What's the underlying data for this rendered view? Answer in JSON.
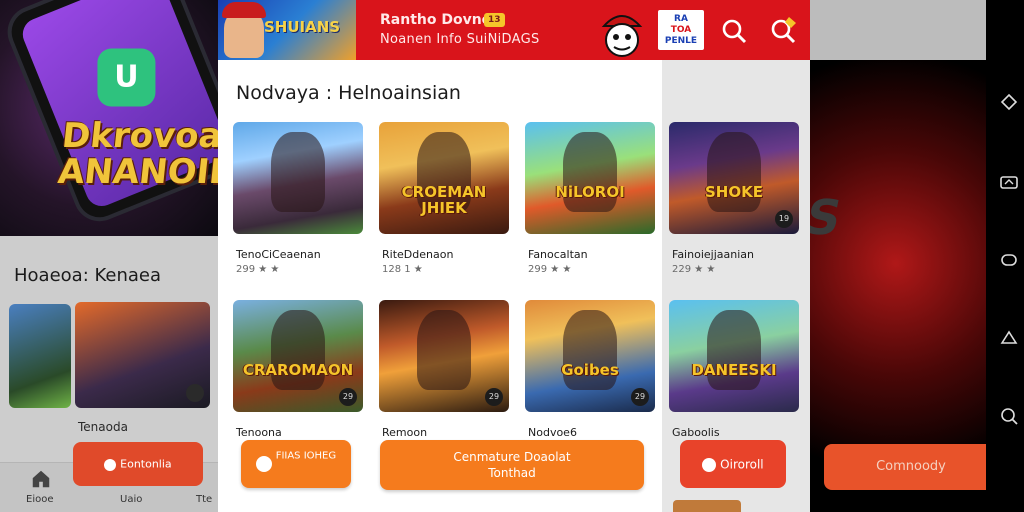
{
  "background_left": {
    "hero_title": "Dkrovoa ANANOIE",
    "section_heading": "Hoaeoa: Kenaea",
    "item_label": "Tenaoda",
    "cta_label": "Eontonlia",
    "nav": [
      {
        "label": "Eiooe"
      },
      {
        "label": "Uaio"
      },
      {
        "label": "Tte"
      }
    ]
  },
  "header": {
    "logo_word": "SHUIANS",
    "title_line1": "Rantho Dovne",
    "badge": "13",
    "title_line2": "Noanen Info SuiNiDAGS",
    "brand_line1": "RA",
    "brand_line2": "TOA",
    "brand_line3": "PENLE"
  },
  "section": {
    "title": "Nodvaya : Helnoainsian"
  },
  "games": [
    {
      "name": "TenoCiCeaenan",
      "meta": "299 ★ ★",
      "art": "robot",
      "tile_text": "",
      "dot": ""
    },
    {
      "name": "RiteDdenaon",
      "meta": "128 1 ★",
      "art": "crew",
      "tile_text": "CROEMAN JHIEK",
      "dot": ""
    },
    {
      "name": "Fanocaltan",
      "meta": "299 ★ ★",
      "art": "heroes",
      "tile_text": "NiLOROI",
      "dot": ""
    },
    {
      "name": "Fainoiejjaanian",
      "meta": "229 ★ ★",
      "art": "army",
      "tile_text": "SHOKE",
      "dot": "19"
    },
    {
      "name": "Tenoona",
      "meta": "",
      "art": "giant",
      "tile_text": "CRAROMAON",
      "dot": "29"
    },
    {
      "name": "Remoon",
      "meta": "",
      "art": "girl",
      "tile_text": "",
      "dot": "29"
    },
    {
      "name": "Nodvoe6",
      "meta": "",
      "art": "boy",
      "tile_text": "Goibes",
      "dot": "29"
    },
    {
      "name": "Gaboolis",
      "meta": "",
      "art": "squad",
      "tile_text": "DANEESKI",
      "dot": ""
    }
  ],
  "actions": {
    "left": "FIIAS IOHEG",
    "center_line1": "Cenmature Doaolat",
    "center_line2": "Tonthad",
    "right": "Oiroroll",
    "far_right": "Comnoody"
  },
  "colors": {
    "header_red": "#d9141b",
    "accent_orange": "#f57b1d"
  }
}
